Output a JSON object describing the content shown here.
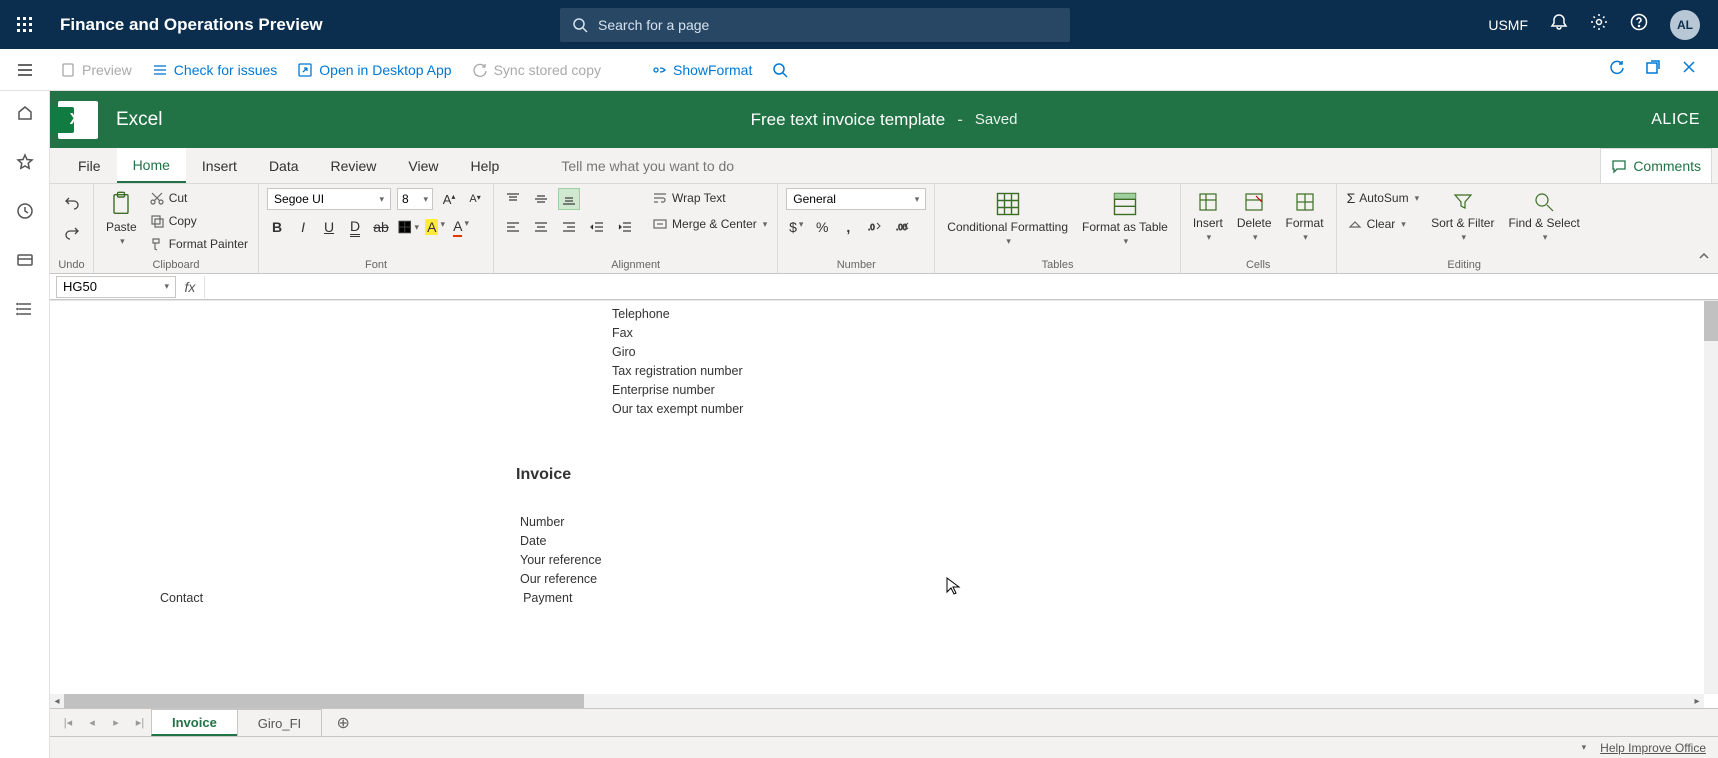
{
  "header": {
    "app_title": "Finance and Operations Preview",
    "search_placeholder": "Search for a page",
    "company": "USMF",
    "avatar": "AL"
  },
  "secondary": {
    "preview": "Preview",
    "check": "Check for issues",
    "open_desktop": "Open in Desktop App",
    "sync": "Sync stored copy",
    "show_format": "ShowFormat"
  },
  "excel": {
    "app": "Excel",
    "doc_title": "Free text invoice template",
    "saved": "Saved",
    "user": "ALICE",
    "tabs": {
      "file": "File",
      "home": "Home",
      "insert": "Insert",
      "data": "Data",
      "review": "Review",
      "view": "View",
      "help": "Help",
      "tell": "Tell me what you want to do",
      "comments": "Comments"
    },
    "ribbon": {
      "undo_label": "Undo",
      "paste": "Paste",
      "cut": "Cut",
      "copy": "Copy",
      "format_painter": "Format Painter",
      "clipboard_label": "Clipboard",
      "font_name": "Segoe UI",
      "font_size": "8",
      "font_label": "Font",
      "wrap": "Wrap Text",
      "merge": "Merge & Center",
      "alignment_label": "Alignment",
      "number_format": "General",
      "number_label": "Number",
      "cond_format": "Conditional Formatting",
      "format_table": "Format as Table",
      "tables_label": "Tables",
      "insert": "Insert",
      "delete": "Delete",
      "format": "Format",
      "cells_label": "Cells",
      "autosum": "AutoSum",
      "clear": "Clear",
      "sort_filter": "Sort & Filter",
      "find_select": "Find & Select",
      "editing_label": "Editing"
    },
    "name_box": "HG50",
    "sheet_tabs": {
      "t1": "Invoice",
      "t2": "Giro_FI"
    },
    "status": {
      "help": "Help Improve Office"
    }
  },
  "sheet": {
    "rows": {
      "telephone": "Telephone",
      "fax": "Fax",
      "giro": "Giro",
      "tax_reg": "Tax registration number",
      "enterprise": "Enterprise number",
      "tax_exempt": "Our tax exempt number",
      "header": "Invoice",
      "number": "Number",
      "date": "Date",
      "your_ref": "Your reference",
      "our_ref": "Our reference",
      "contact": "Contact",
      "payment": "Payment"
    }
  }
}
